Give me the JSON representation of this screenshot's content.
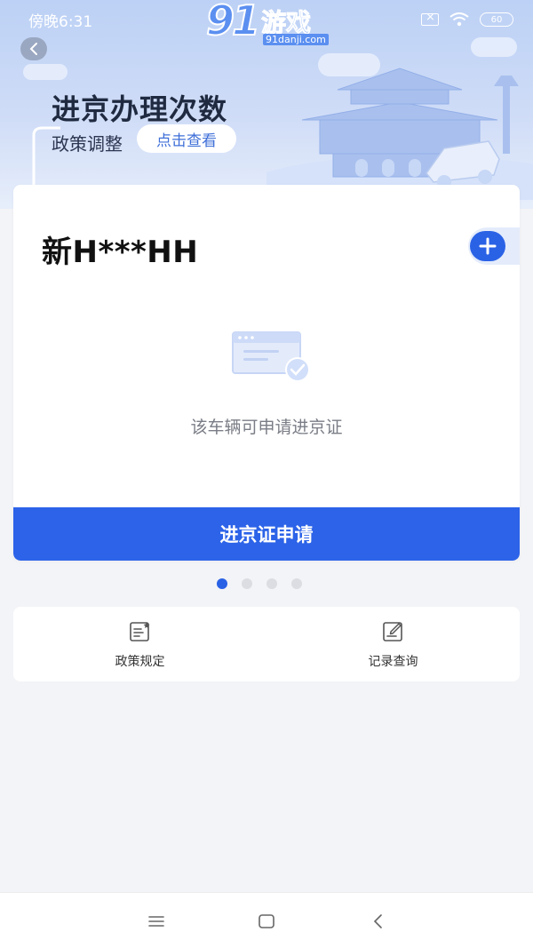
{
  "status_bar": {
    "time": "傍晚6:31",
    "battery": "60"
  },
  "watermark": {
    "logo": "91",
    "name": "游戏",
    "url": "91danji.com"
  },
  "banner": {
    "title": "进京办理次数",
    "subtitle": "政策调整",
    "view_button": "点击查看"
  },
  "vehicle": {
    "plate": "新H***HH",
    "status_text": "该车辆可申请进京证",
    "apply_button": "进京证申请"
  },
  "pager": {
    "total": 4,
    "active_index": 0
  },
  "quick_links": [
    {
      "label": "政策规定",
      "icon": "policy-doc-icon"
    },
    {
      "label": "记录查询",
      "icon": "record-edit-icon"
    }
  ],
  "colors": {
    "primary": "#2c63e8",
    "banner_top": "#bcd1f5",
    "page_bg": "#f3f4f7"
  }
}
